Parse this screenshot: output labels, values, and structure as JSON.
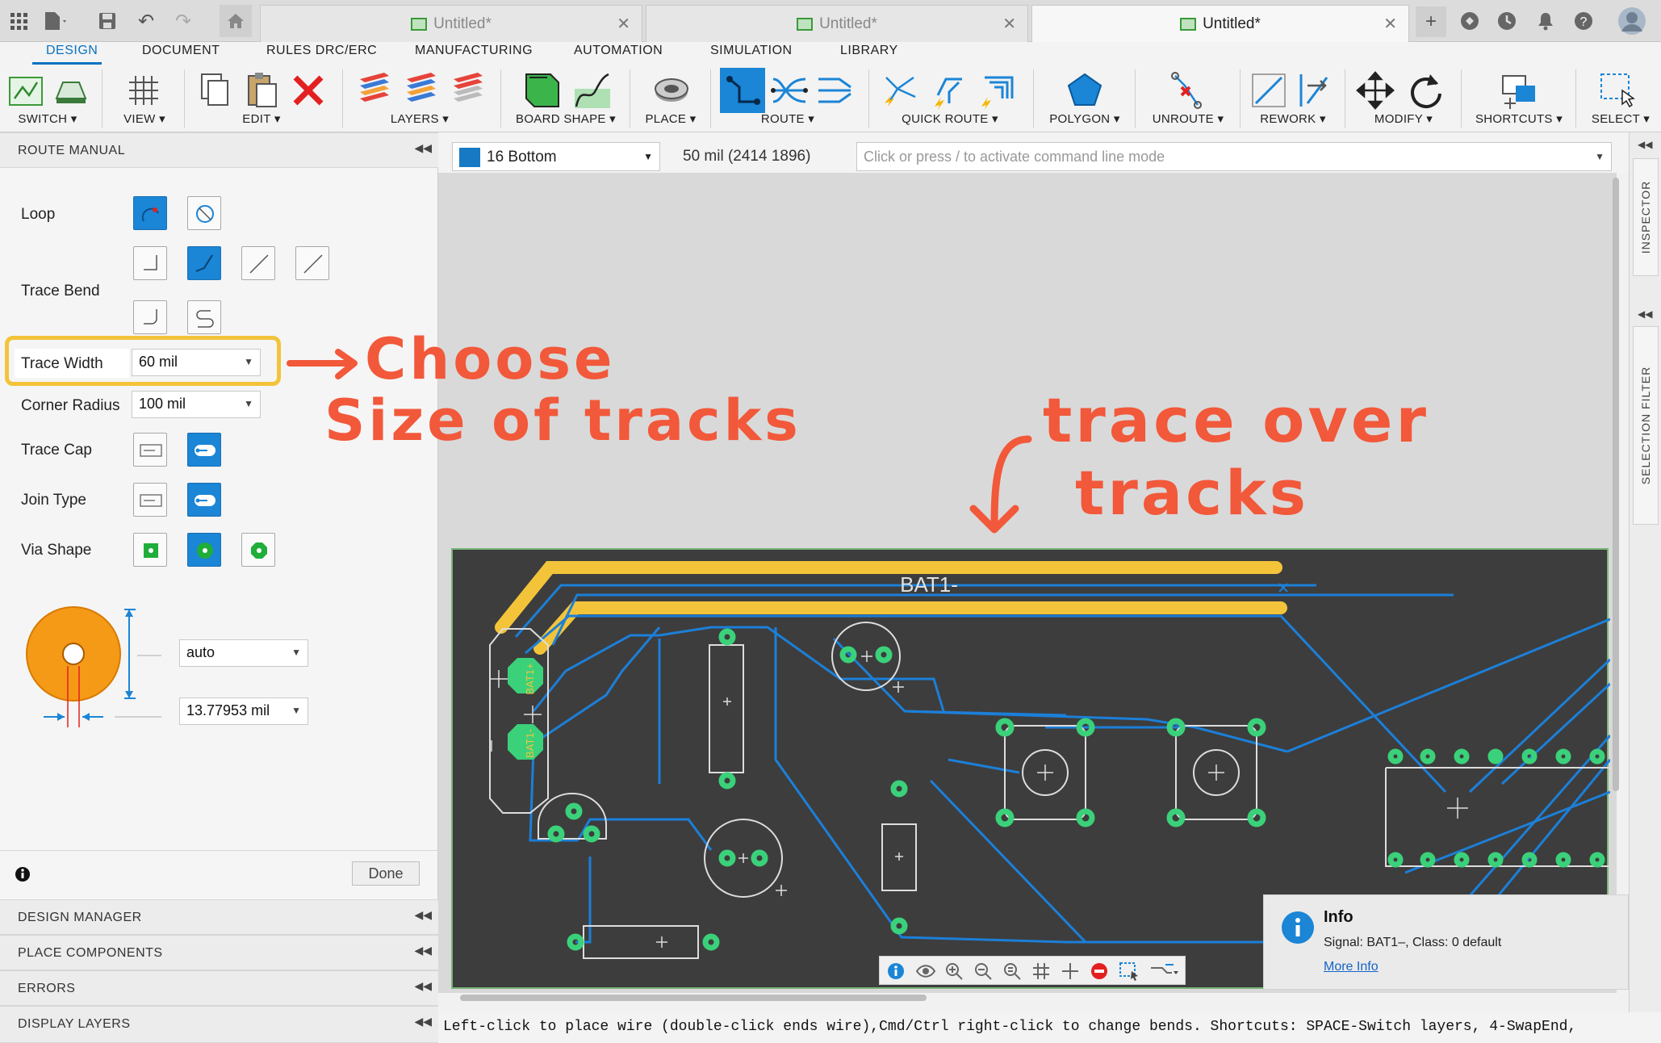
{
  "tabs": [
    {
      "label": "Untitled*"
    },
    {
      "label": "Untitled*"
    },
    {
      "label": "Untitled*"
    }
  ],
  "menu": [
    "DESIGN",
    "DOCUMENT",
    "RULES DRC/ERC",
    "MANUFACTURING",
    "AUTOMATION",
    "SIMULATION",
    "LIBRARY"
  ],
  "ribbon": {
    "switch": "SWITCH ▾",
    "view": "VIEW ▾",
    "edit": "EDIT ▾",
    "layers": "LAYERS ▾",
    "board_shape": "BOARD SHAPE ▾",
    "place": "PLACE ▾",
    "route": "ROUTE ▾",
    "quick_route": "QUICK ROUTE ▾",
    "polygon": "POLYGON ▾",
    "unroute": "UNROUTE ▾",
    "rework": "REWORK ▾",
    "modify": "MODIFY ▾",
    "shortcuts": "SHORTCUTS ▾",
    "select": "SELECT ▾"
  },
  "panel": {
    "title": "ROUTE MANUAL",
    "loop": "Loop",
    "trace_bend": "Trace Bend",
    "trace_width": "Trace Width",
    "trace_width_val": "60 mil",
    "corner_radius": "Corner Radius",
    "corner_radius_val": "100 mil",
    "trace_cap": "Trace Cap",
    "join_type": "Join Type",
    "via_shape": "Via Shape",
    "drill_val": "auto",
    "diameter_val": "13.77953 mil",
    "done": "Done"
  },
  "sections": [
    "DESIGN MANAGER",
    "PLACE COMPONENTS",
    "ERRORS",
    "DISPLAY LAYERS"
  ],
  "toolbar": {
    "layer": "16 Bottom",
    "coords": "50 mil (2414 1896)",
    "cmd_placeholder": "Click or press / to activate command line mode"
  },
  "pcb": {
    "signal_label": "BAT1-",
    "bat_plus": "BAT1+",
    "bat_minus": "BAT1-"
  },
  "info": {
    "title": "Info",
    "text": "Signal: BAT1–, Class: 0 default",
    "link": "More Info"
  },
  "right_tabs": {
    "inspector": "INSPECTOR",
    "selection_filter": "SELECTION FILTER"
  },
  "status": "Left-click to place wire (double-click ends wire),Cmd/Ctrl right-click to change bends. Shortcuts: SPACE-Switch layers, 4-SwapEnd,",
  "annotations": {
    "a1_line1": "Choose",
    "a1_line2": "Size of tracks",
    "a2_line1": "trace over",
    "a2_line2": "tracks"
  },
  "colors": {
    "accent": "#0a72c2",
    "pcb_bg": "#3d3d3d",
    "trace": "#1c7fd8",
    "highlight": "#f3c43a",
    "annotation": "#f2583a",
    "pad": "#3ad17a"
  }
}
